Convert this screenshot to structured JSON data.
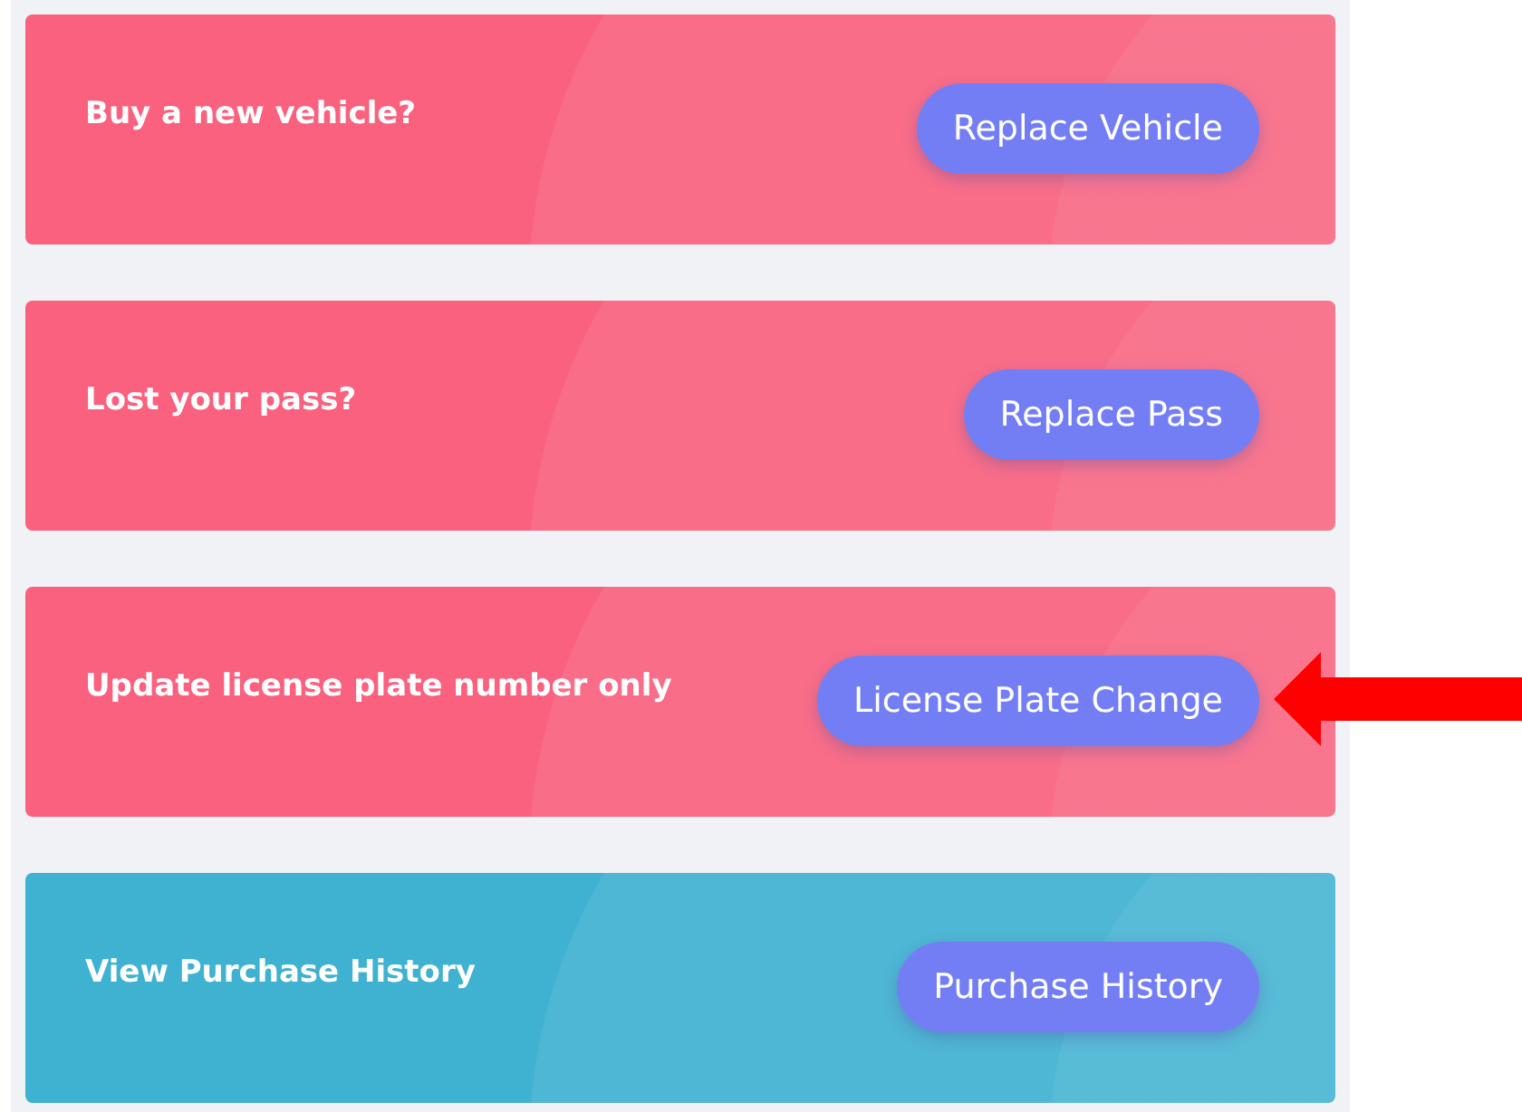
{
  "cards": [
    {
      "title": "Buy a new vehicle?",
      "button": "Replace Vehicle",
      "color": "#f9617e",
      "marked": false
    },
    {
      "title": "Lost your pass?",
      "button": "Replace Pass",
      "color": "#f9617e",
      "marked": false
    },
    {
      "title": "Update license plate number only",
      "button": "License Plate Change",
      "color": "#f9617e",
      "marked": true
    },
    {
      "title": "View Purchase History",
      "button": "Purchase History",
      "color": "#3fb1d1",
      "marked": false
    }
  ]
}
